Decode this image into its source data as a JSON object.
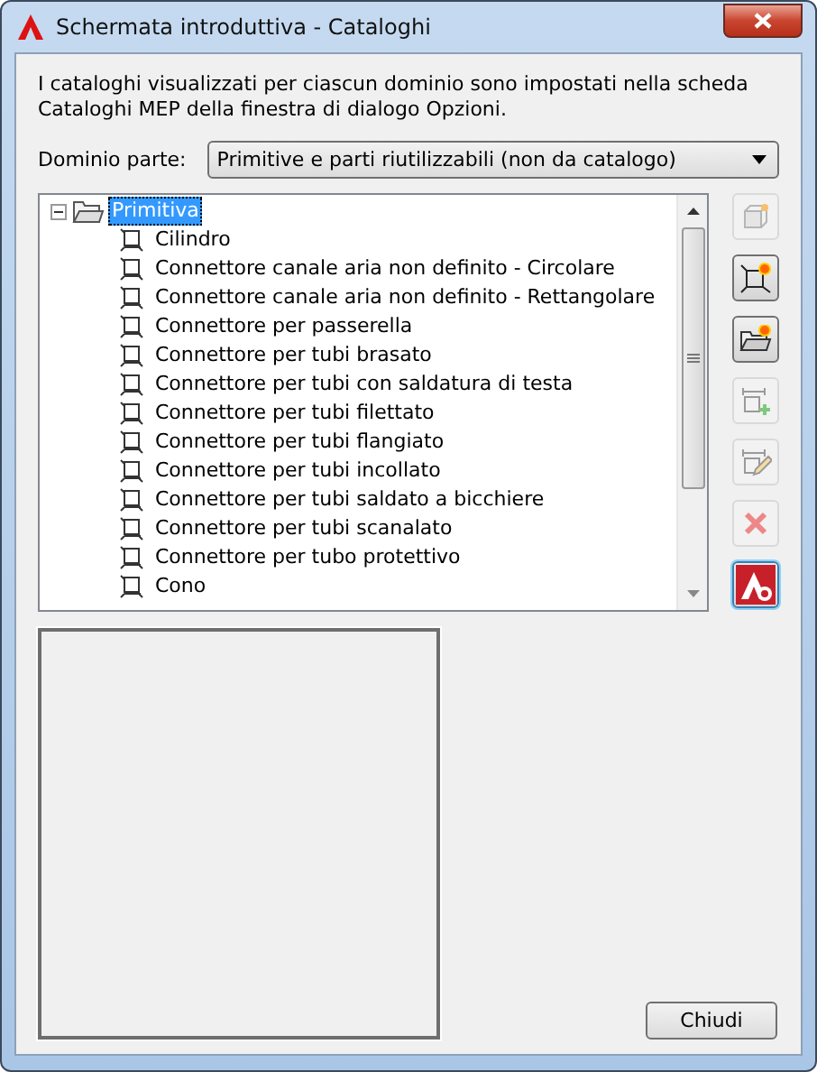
{
  "window": {
    "title": "Schermata introduttiva - Cataloghi"
  },
  "description": "I cataloghi visualizzati per ciascun dominio sono impostati nella scheda Cataloghi MEP della finestra di dialogo Opzioni.",
  "domain": {
    "label": "Dominio parte:",
    "value": "Primitive e parti riutilizzabili (non da catalogo)"
  },
  "tree": [
    {
      "label": "Primitiva",
      "expanded": true,
      "selected": true,
      "children": [
        {
          "label": "Cilindro",
          "selected": false
        },
        {
          "label": "Connettore canale aria non definito - Circolare",
          "selected": false
        },
        {
          "label": "Connettore canale aria non definito - Rettangolare",
          "selected": false
        },
        {
          "label": "Connettore per passerella",
          "selected": false
        },
        {
          "label": "Connettore per tubi brasato",
          "selected": false
        },
        {
          "label": "Connettore per tubi con saldatura di testa",
          "selected": false
        },
        {
          "label": "Connettore per tubi filettato",
          "selected": false
        },
        {
          "label": "Connettore per tubi flangiato",
          "selected": false
        },
        {
          "label": "Connettore per tubi incollato",
          "selected": false
        },
        {
          "label": "Connettore per tubi saldato a bicchiere",
          "selected": false
        },
        {
          "label": "Connettore per tubi scanalato",
          "selected": false
        },
        {
          "label": "Connettore per tubo protettivo",
          "selected": false
        },
        {
          "label": "Cono",
          "selected": false
        }
      ]
    }
  ],
  "tools": [
    {
      "kind": "part",
      "disabled": true
    },
    {
      "kind": "new-part",
      "disabled": false
    },
    {
      "kind": "new-folder",
      "disabled": false
    },
    {
      "kind": "add",
      "disabled": true
    },
    {
      "kind": "edit",
      "disabled": true
    },
    {
      "kind": "delete",
      "disabled": true
    },
    {
      "kind": "help",
      "disabled": false
    }
  ],
  "buttons": [
    "Chiudi"
  ]
}
